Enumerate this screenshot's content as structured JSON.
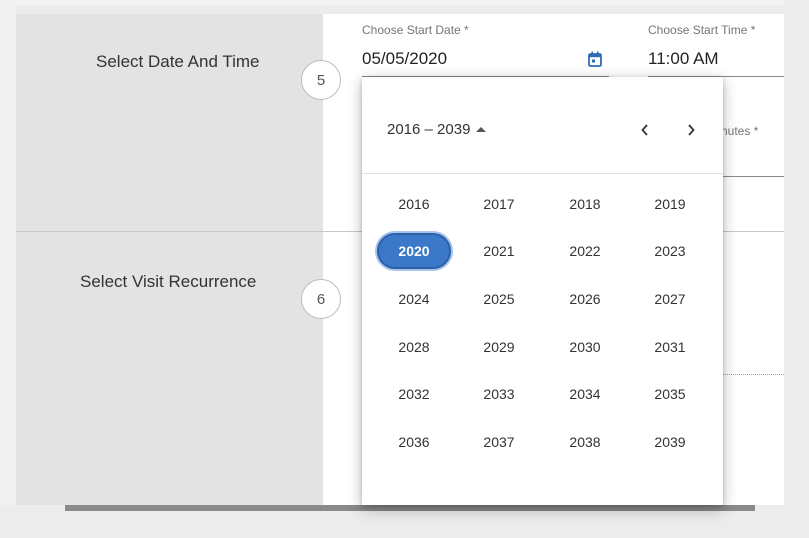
{
  "steps": [
    {
      "number": "5",
      "label": "Select Date And Time"
    },
    {
      "number": "6",
      "label": "Select Visit Recurrence"
    }
  ],
  "start_date": {
    "label": "Choose Start Date *",
    "value": "05/05/2020"
  },
  "start_time": {
    "label": "Choose Start Time *",
    "value": "11:00 AM"
  },
  "duration_fragment": {
    "label": "nutes *"
  },
  "picker": {
    "period": "2016 – 2039",
    "selected_year": "2020",
    "years": [
      "2016",
      "2017",
      "2018",
      "2019",
      "2020",
      "2021",
      "2022",
      "2023",
      "2024",
      "2025",
      "2026",
      "2027",
      "2028",
      "2029",
      "2030",
      "2031",
      "2032",
      "2033",
      "2034",
      "2035",
      "2036",
      "2037",
      "2038",
      "2039"
    ]
  },
  "icons": {
    "calendar": "calendar-icon",
    "prev": "chevron-left-icon",
    "next": "chevron-right-icon",
    "period": "caret-up-icon"
  },
  "colors": {
    "accent": "#3c78c8",
    "calendar_icon": "#2d6cb5"
  }
}
